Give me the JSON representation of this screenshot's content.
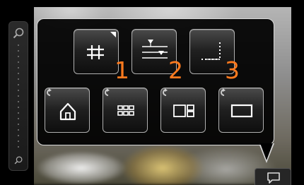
{
  "grid_buttons": [
    {
      "name": "grid-lines",
      "icon": "grid-icon",
      "number": "1",
      "has_corner_indicator": true
    },
    {
      "name": "level-lines",
      "icon": "level-lines-icon",
      "number": "2",
      "has_corner_indicator": false
    },
    {
      "name": "corner-guide",
      "icon": "corner-guide-icon",
      "number": "3",
      "has_corner_indicator": false
    }
  ],
  "layout_buttons": [
    {
      "name": "home",
      "icon": "home-icon"
    },
    {
      "name": "thumbnail-grid",
      "icon": "thumbnail-grid-icon"
    },
    {
      "name": "split-view",
      "icon": "split-view-icon"
    },
    {
      "name": "full-frame",
      "icon": "full-frame-icon"
    }
  ],
  "colors": {
    "number_accent": "#ff7a1e",
    "panel_border": "#d8d8d8"
  },
  "labels": {
    "n1": "1",
    "n2": "2",
    "n3": "3"
  }
}
